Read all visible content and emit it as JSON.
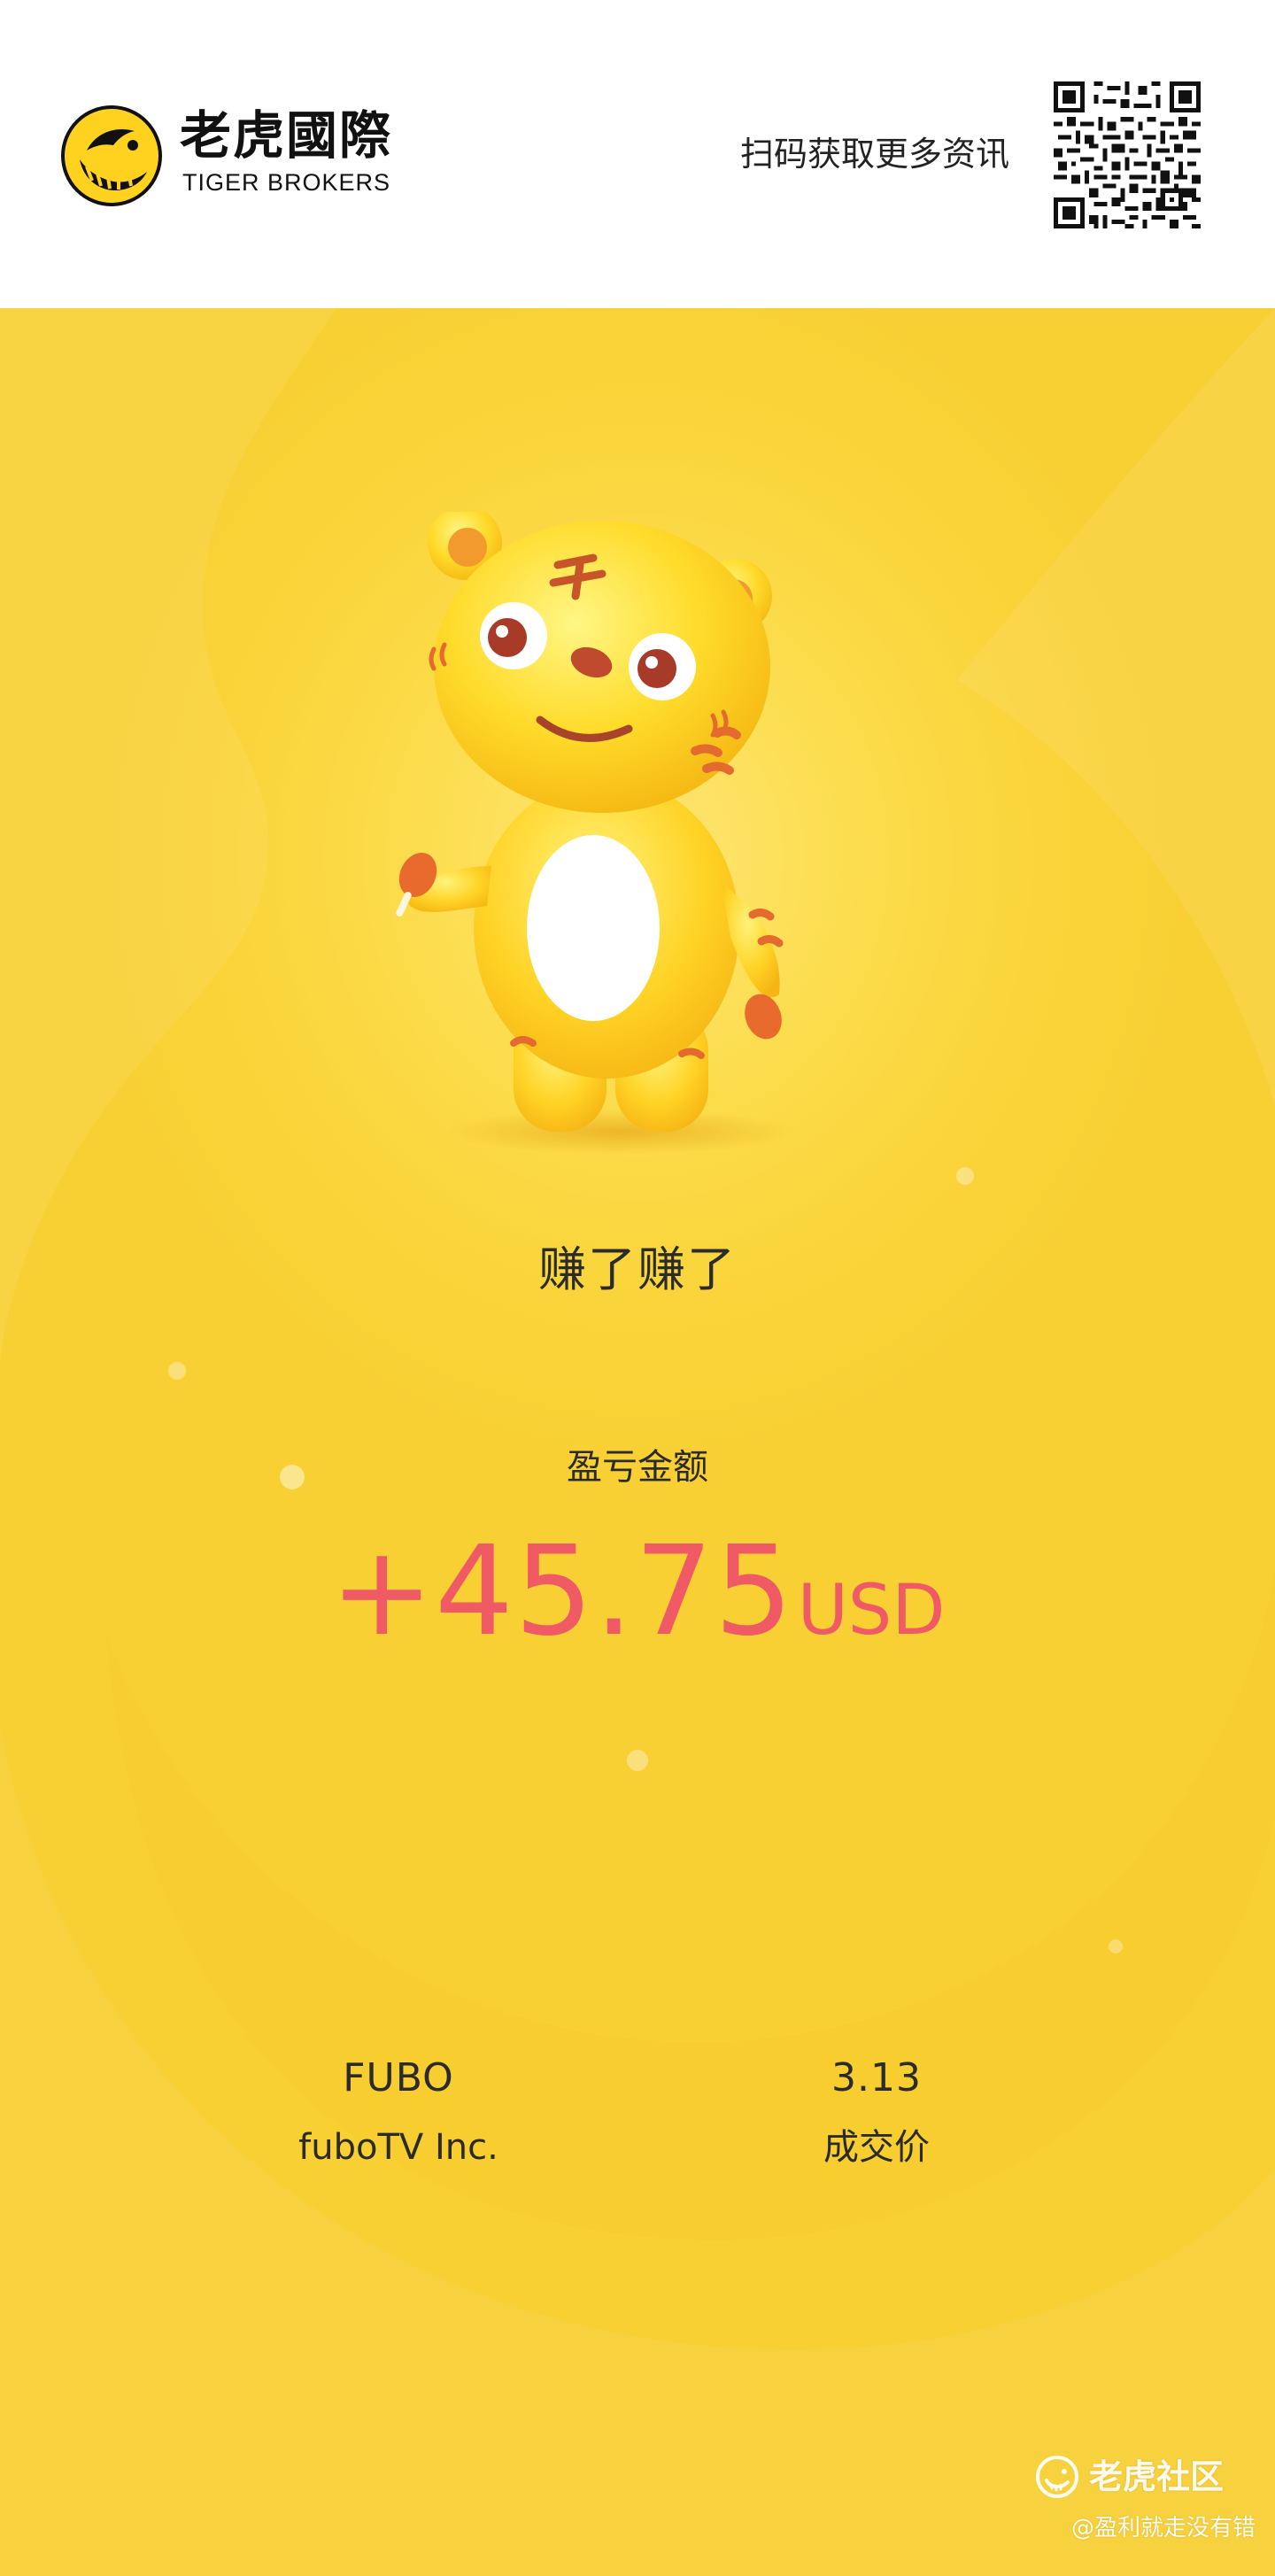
{
  "header": {
    "brand_name_cn": "老虎國際",
    "brand_name_en": "TIGER BROKERS",
    "scan_prompt": "扫码获取更多资讯",
    "logo_icon": "tiger-stripe-logo-icon",
    "qr_icon": "qr-code-icon"
  },
  "card": {
    "headline": "赚了赚了",
    "pnl_label": "盈亏金额",
    "pnl_value": "+45.75",
    "pnl_currency": "USD",
    "stock": {
      "symbol": "FUBO",
      "name": "fuboTV Inc."
    },
    "price": {
      "value": "3.13",
      "label": "成交价"
    },
    "mascot_icon": "tiger-mascot-illustration"
  },
  "watermark": {
    "title": "老虎社区",
    "user": "@盈利就走没有错",
    "icon": "community-logo-icon"
  },
  "colors": {
    "card_yellow": "#fad43a",
    "profit_red": "#ef5a64",
    "text_dark": "#2b2b2b",
    "header_bg": "#ffffff"
  }
}
